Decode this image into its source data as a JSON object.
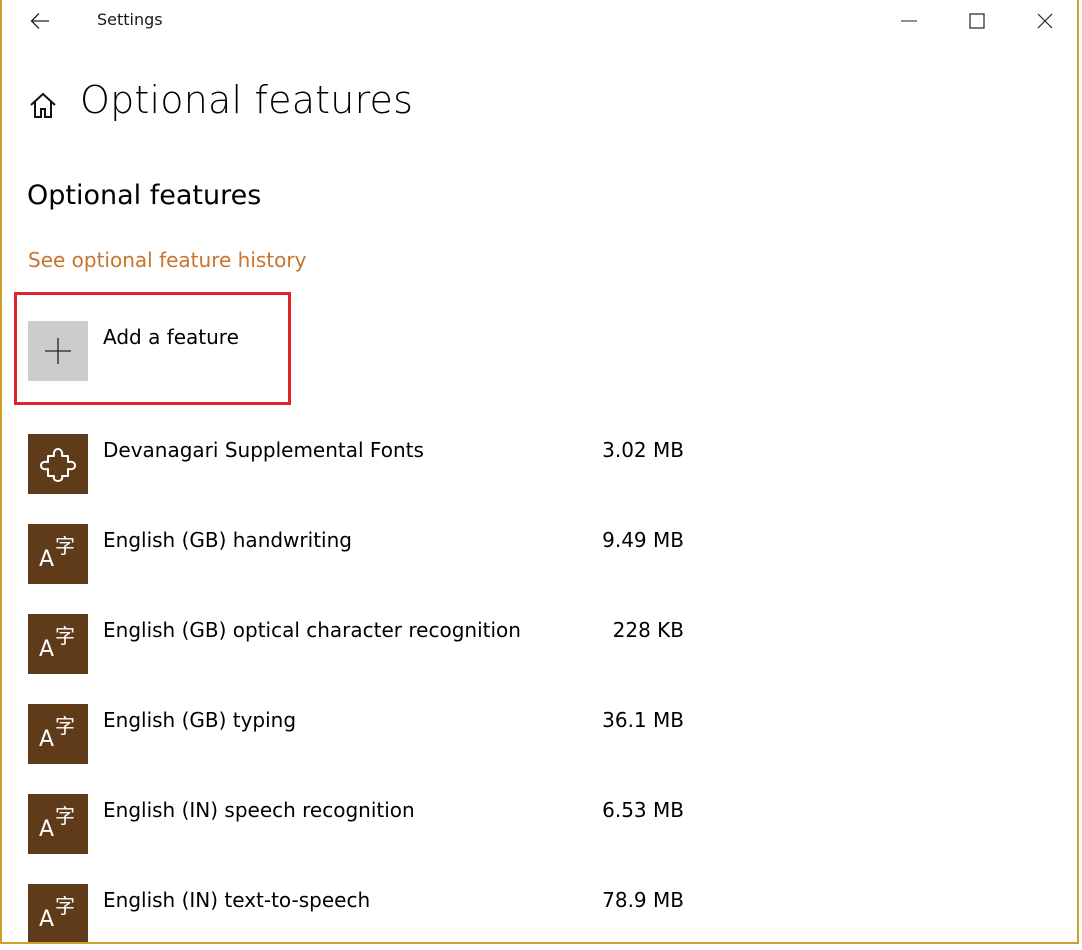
{
  "window": {
    "title": "Settings",
    "accent_color": "#c8742c",
    "tile_color": "#5f3b1a"
  },
  "header": {
    "page_title": "Optional features"
  },
  "main": {
    "section_title": "Optional features",
    "history_link": "See optional feature history",
    "add_feature_label": "Add a feature",
    "features": [
      {
        "name": "Devanagari Supplemental Fonts",
        "size": "3.02 MB",
        "icon": "puzzle-piece-icon"
      },
      {
        "name": "English (GB) handwriting",
        "size": "9.49 MB",
        "icon": "language-icon"
      },
      {
        "name": "English (GB) optical character recognition",
        "size": "228 KB",
        "icon": "language-icon"
      },
      {
        "name": "English (GB) typing",
        "size": "36.1 MB",
        "icon": "language-icon"
      },
      {
        "name": "English (IN) speech recognition",
        "size": "6.53 MB",
        "icon": "language-icon"
      },
      {
        "name": "English (IN) text-to-speech",
        "size": "78.9 MB",
        "icon": "language-icon"
      }
    ]
  }
}
